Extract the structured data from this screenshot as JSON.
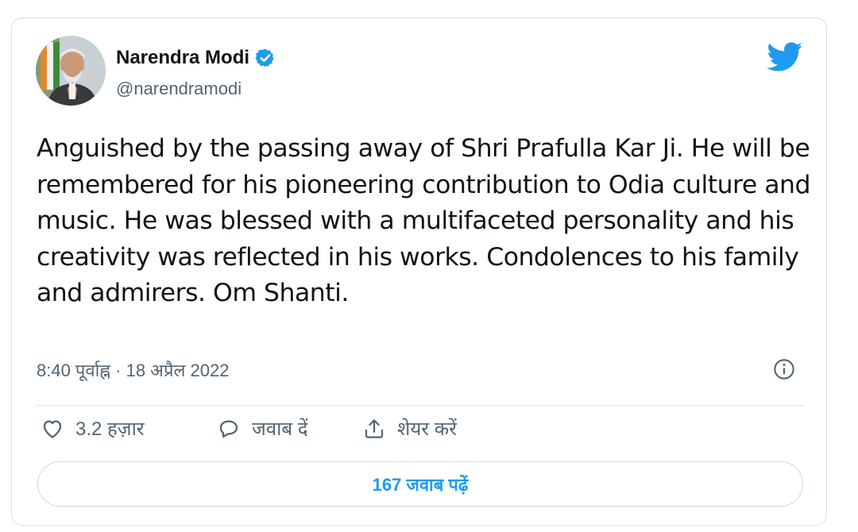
{
  "author": {
    "name": "Narendra Modi",
    "handle": "@narendramodi",
    "avatar_icon": "profile-photo",
    "verified_icon": "verified-badge-icon"
  },
  "brand": {
    "icon": "twitter-bird-icon",
    "color": "#1d9bf0"
  },
  "tweet": {
    "text": "Anguished by the passing away of Shri Prafulla Kar Ji. He will be remembered for his pioneering contribution to Odia culture and music. He was blessed with a multifaceted personality and his creativity was reflected in his works. Condolences to his family and admirers. Om Shanti.",
    "time": "8:40 पूर्वाह्न · 18 अप्रैल 2022"
  },
  "actions": {
    "like_count": "3.2 हज़ार",
    "reply_label": "जवाब दें",
    "share_label": "शेयर करें"
  },
  "read_replies_label": "167 जवाब पढ़ें",
  "colors": {
    "text": "#0f1419",
    "muted": "#536471",
    "accent": "#1d9bf0"
  }
}
